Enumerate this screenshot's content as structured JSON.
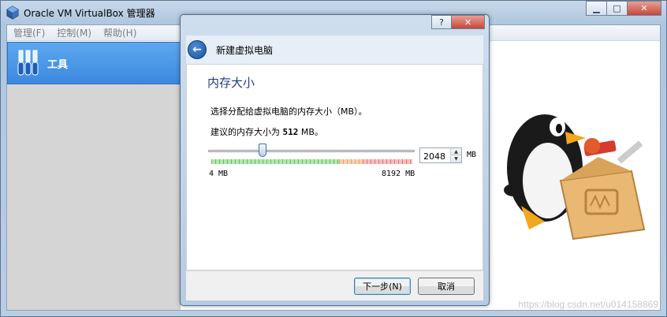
{
  "app": {
    "title": "Oracle VM VirtualBox 管理器",
    "window_controls": {
      "minimize": "▁",
      "maximize": "□",
      "close": "✕"
    }
  },
  "menu": [
    "管理(F)",
    "控制(M)",
    "帮助(H)"
  ],
  "sidebar": {
    "tools_label": "工具"
  },
  "watermark": "https://blog.csdn.net/u014158869",
  "dialog": {
    "controls": {
      "help": "?",
      "close": "✕"
    },
    "back_glyph": "←",
    "title": "新建虚拟电脑",
    "heading": "内存大小",
    "description": "选择分配给虚拟电脑的内存大小（MB）。",
    "recommend_prefix": "建议的内存大小为 ",
    "recommend_value": "512",
    "recommend_suffix": " MB。",
    "memory": {
      "value": "2048",
      "unit": "MB",
      "min_label": "4 MB",
      "max_label": "8192 MB",
      "min": 4,
      "max": 8192,
      "current": 2048
    },
    "buttons": {
      "next": "下一步(N)",
      "cancel": "取消"
    }
  },
  "colors": {
    "accent": "#3b89e0",
    "scale_safe": "#5fc15f",
    "scale_warn": "#e6a66a",
    "scale_danger": "#e77070"
  },
  "icons": [
    "virtualbox-icon",
    "tools-icon",
    "back-arrow-icon",
    "help-icon",
    "close-icon",
    "penguin-toolbox-icon"
  ]
}
